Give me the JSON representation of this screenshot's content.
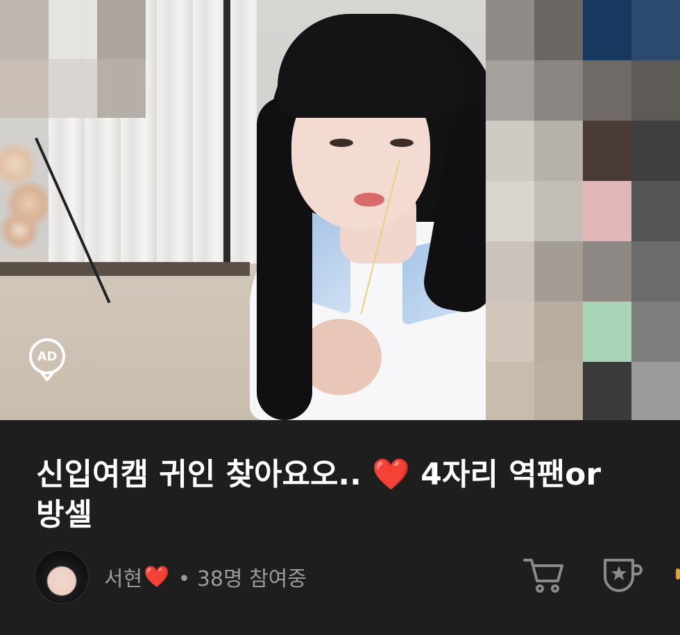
{
  "video": {
    "ad_badge": "AD"
  },
  "stream": {
    "title_part1": "신입여캠 귀인 찾아요오.. ",
    "title_heart": "❤️",
    "title_part2": " 4자리 역팬or방셀",
    "streamer_name": "서현",
    "streamer_heart": "❤️",
    "viewers": "• 38명 참여중"
  },
  "icons": {
    "cart": "cart-icon",
    "star_cup": "star-cup-icon"
  },
  "colors": {
    "background": "#1e1e1e",
    "title_text": "#ffffff",
    "meta_text": "#9a9a9a",
    "heart": "#e31b23"
  }
}
